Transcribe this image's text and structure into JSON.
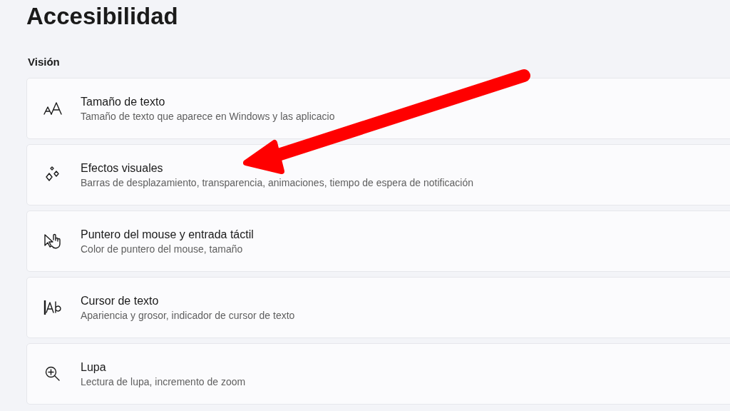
{
  "page": {
    "title": "Accesibilidad"
  },
  "section": {
    "heading": "Visión"
  },
  "items": [
    {
      "kind": "text-size",
      "title": "Tamaño de texto",
      "subtitle": "Tamaño de texto que aparece en Windows y las aplicacio"
    },
    {
      "kind": "effects",
      "title": "Efectos visuales",
      "subtitle": "Barras de desplazamiento, transparencia, animaciones, tiempo de espera de notificación"
    },
    {
      "kind": "pointer",
      "title": "Puntero del mouse y entrada táctil",
      "subtitle": "Color de puntero del mouse, tamaño"
    },
    {
      "kind": "cursor",
      "title": "Cursor de texto",
      "subtitle": "Apariencia y grosor, indicador de cursor de texto"
    },
    {
      "kind": "magnifier",
      "title": "Lupa",
      "subtitle": "Lectura de lupa, incremento de zoom"
    }
  ]
}
